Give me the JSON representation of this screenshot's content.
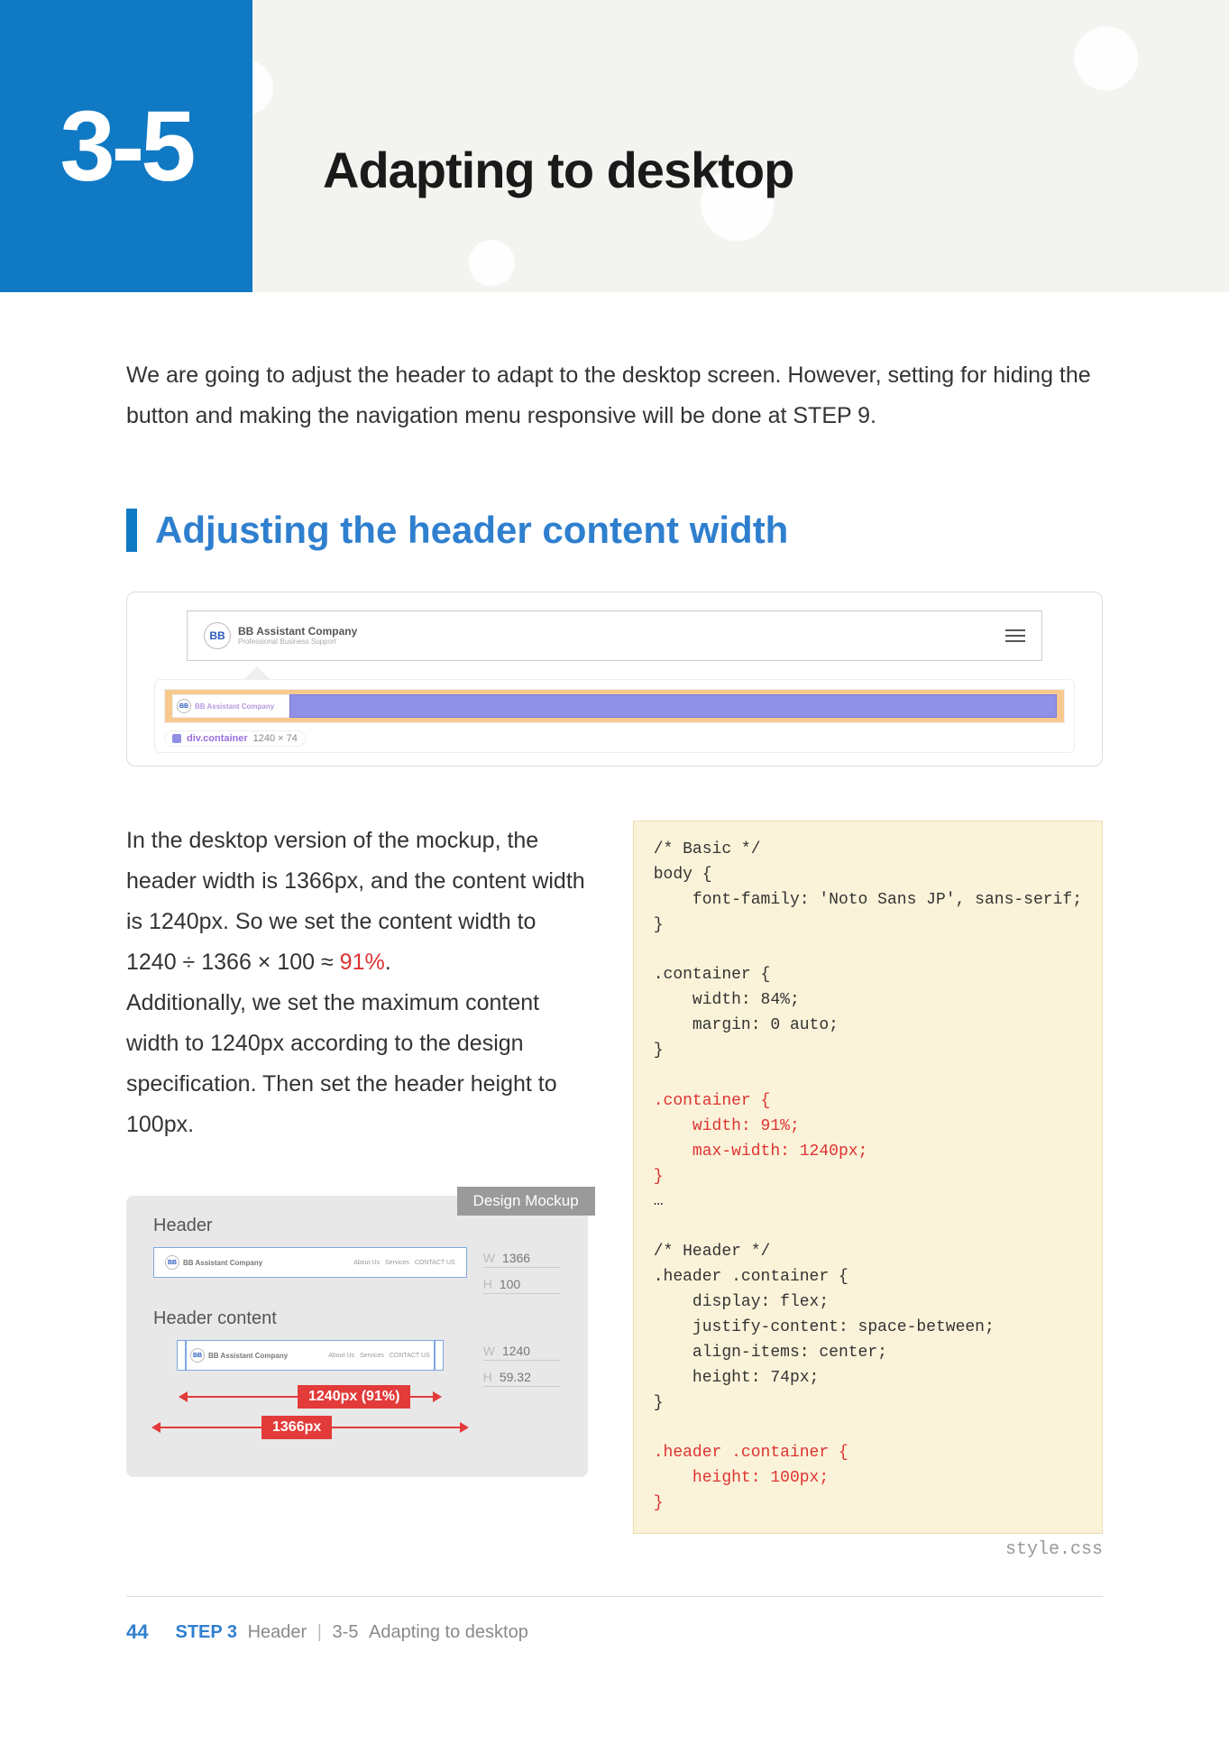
{
  "banner": {
    "section_number": "3-5",
    "title": "Adapting to desktop"
  },
  "intro": "We are going to adjust the header to adapt to the desktop screen. However, setting for hiding the button and making the navigation menu responsive will be done at STEP 9.",
  "section_heading": "Adjusting the header content width",
  "mock": {
    "logo_initials": "BB",
    "logo_text": "BB Assistant Company",
    "logo_sub": "Professional Business Support",
    "devtools_element_tag": "div.container",
    "devtools_element_size": "1240 × 74"
  },
  "body": {
    "p1a": "In the desktop version of the mockup, the header width is 1366px, and the content width is 1240px. So we set the content width to 1240 ÷ 1366 × 100 ≈ ",
    "p1_red": "91%",
    "p1b": ".",
    "p2": "Additionally, we set the maximum content width to 1240px according to the design specification. Then set the header height to 100px."
  },
  "code": {
    "lines_before": "/* Basic */\nbody {\n    font-family: 'Noto Sans JP', sans-serif;\n}\n\n.container {\n    width: 84%;\n    margin: 0 auto;\n}\n",
    "lines_hl1": ".container {\n    width: 91%;\n    max-width: 1240px;\n}",
    "lines_mid": "\n…\n\n/* Header */\n.header .container {\n    display: flex;\n    justify-content: space-between;\n    align-items: center;\n    height: 74px;\n}\n",
    "lines_hl2": ".header .container {\n    height: 100px;\n}",
    "filename": "style.css"
  },
  "design": {
    "tab": "Design Mockup",
    "label_header": "Header",
    "label_header_content": "Header content",
    "mini_logo_initials": "BB",
    "mini_logo_text": "BB Assistant Company",
    "mini_nav_items": [
      "About Us",
      "Services",
      "CONTACT US"
    ],
    "dims_header": {
      "w": "1366",
      "h": "100"
    },
    "dims_content": {
      "w": "1240",
      "h": "59.32"
    },
    "badge_91": "1240px (91%)",
    "badge_1366": "1366px"
  },
  "footer": {
    "page_number": "44",
    "step_label": "STEP 3",
    "step_name": "Header",
    "crumb_num": "3-5",
    "crumb_name": "Adapting to desktop"
  }
}
